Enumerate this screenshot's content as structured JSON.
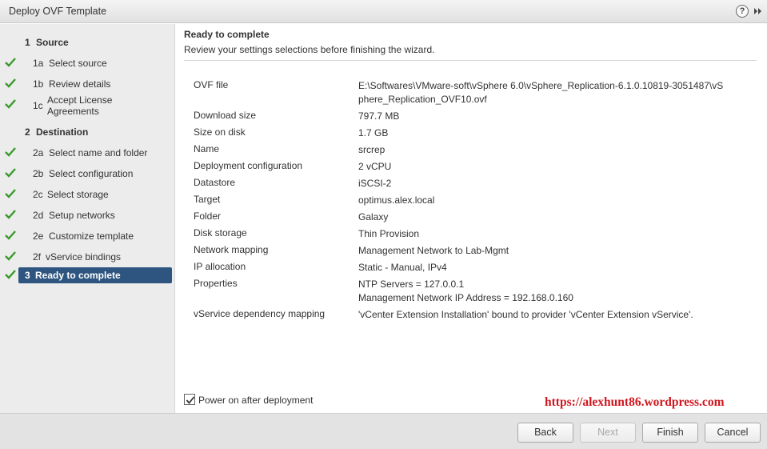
{
  "window": {
    "title": "Deploy OVF Template",
    "help_label": "?"
  },
  "steps": [
    {
      "num": "1",
      "label": "Source",
      "type": "header",
      "done": false
    },
    {
      "num": "1a",
      "label": "Select source",
      "type": "sub",
      "done": true
    },
    {
      "num": "1b",
      "label": "Review details",
      "type": "sub",
      "done": true
    },
    {
      "num": "1c",
      "label": "Accept License Agreements",
      "type": "sub",
      "done": true
    },
    {
      "num": "2",
      "label": "Destination",
      "type": "header",
      "done": false
    },
    {
      "num": "2a",
      "label": "Select name and folder",
      "type": "sub",
      "done": true
    },
    {
      "num": "2b",
      "label": "Select configuration",
      "type": "sub",
      "done": true
    },
    {
      "num": "2c",
      "label": "Select storage",
      "type": "sub",
      "done": true
    },
    {
      "num": "2d",
      "label": "Setup networks",
      "type": "sub",
      "done": true
    },
    {
      "num": "2e",
      "label": "Customize template",
      "type": "sub",
      "done": true
    },
    {
      "num": "2f",
      "label": "vService bindings",
      "type": "sub",
      "done": true
    },
    {
      "num": "3",
      "label": "Ready to complete",
      "type": "active",
      "done": true
    }
  ],
  "main": {
    "heading": "Ready to complete",
    "subtitle": "Review your settings selections before finishing the wizard."
  },
  "settings": [
    {
      "key": "OVF file",
      "value": "E:\\Softwares\\VMware-soft\\vSphere 6.0\\vSphere_Replication-6.1.0.10819-3051487\\vSphere_Replication_OVF10.ovf"
    },
    {
      "key": "Download size",
      "value": "797.7 MB"
    },
    {
      "key": "Size on disk",
      "value": "1.7 GB"
    },
    {
      "key": "Name",
      "value": "srcrep"
    },
    {
      "key": "Deployment configuration",
      "value": "2 vCPU"
    },
    {
      "key": "Datastore",
      "value": "iSCSI-2"
    },
    {
      "key": "Target",
      "value": "optimus.alex.local"
    },
    {
      "key": "Folder",
      "value": "Galaxy"
    },
    {
      "key": "Disk storage",
      "value": "Thin Provision"
    },
    {
      "key": "Network mapping",
      "value": "Management Network to Lab-Mgmt"
    },
    {
      "key": "IP allocation",
      "value": "Static - Manual, IPv4"
    },
    {
      "key": "Properties",
      "value": "NTP Servers = 127.0.0.1\nManagement Network IP Address = 192.168.0.160"
    },
    {
      "key": "vService dependency mapping",
      "value": "'vCenter Extension Installation' bound to provider 'vCenter Extension vService'."
    }
  ],
  "power_on": {
    "label": "Power on after deployment",
    "checked": true
  },
  "watermark": "https://alexhunt86.wordpress.com",
  "buttons": {
    "back": "Back",
    "next": "Next",
    "finish": "Finish",
    "cancel": "Cancel"
  },
  "colors": {
    "accent": "#2e5580",
    "check": "#3a9a2c",
    "watermark": "#d0161e"
  }
}
